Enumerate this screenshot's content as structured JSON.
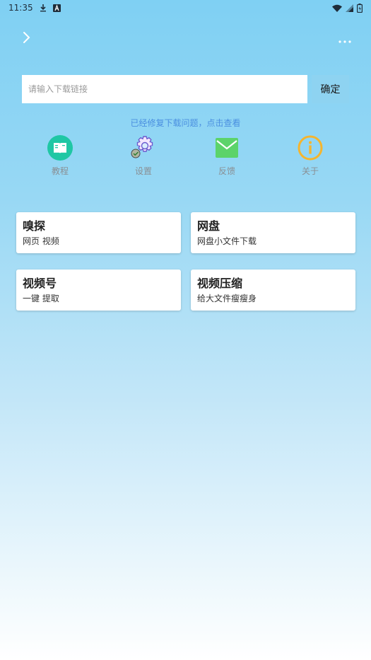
{
  "status_bar": {
    "time": "11:35",
    "icons_left": [
      "download-icon",
      "a-badge-icon"
    ],
    "icons_right": [
      "wifi-icon",
      "signal-icon",
      "battery-icon"
    ]
  },
  "top_bar": {
    "left_icon": "chevron-right-icon",
    "right_icon": "more-dots-icon"
  },
  "search": {
    "placeholder": "请输入下载链接",
    "value": "",
    "confirm_label": "确定"
  },
  "notice": "已经修复下载问题，点击查看",
  "quick_actions": [
    {
      "label": "教程",
      "icon": "book-icon",
      "color": "#1fc7a4"
    },
    {
      "label": "设置",
      "icon": "gear-icon",
      "color": "#6a5acd"
    },
    {
      "label": "反馈",
      "icon": "mail-icon",
      "color": "#5cd36a"
    },
    {
      "label": "关于",
      "icon": "info-icon",
      "color": "#f5b52e"
    }
  ],
  "cards": [
    {
      "title": "嗅探",
      "subtitle": "网页 视频"
    },
    {
      "title": "网盘",
      "subtitle": "网盘小文件下载"
    },
    {
      "title": "视频号",
      "subtitle": "一键 提取"
    },
    {
      "title": "视频压缩",
      "subtitle": "给大文件瘦瘦身"
    }
  ],
  "colors": {
    "accent": "#8ed3f1",
    "notice": "#4a8fe0",
    "background_top": "#7fd0f3",
    "background_bottom": "#ffffff"
  }
}
